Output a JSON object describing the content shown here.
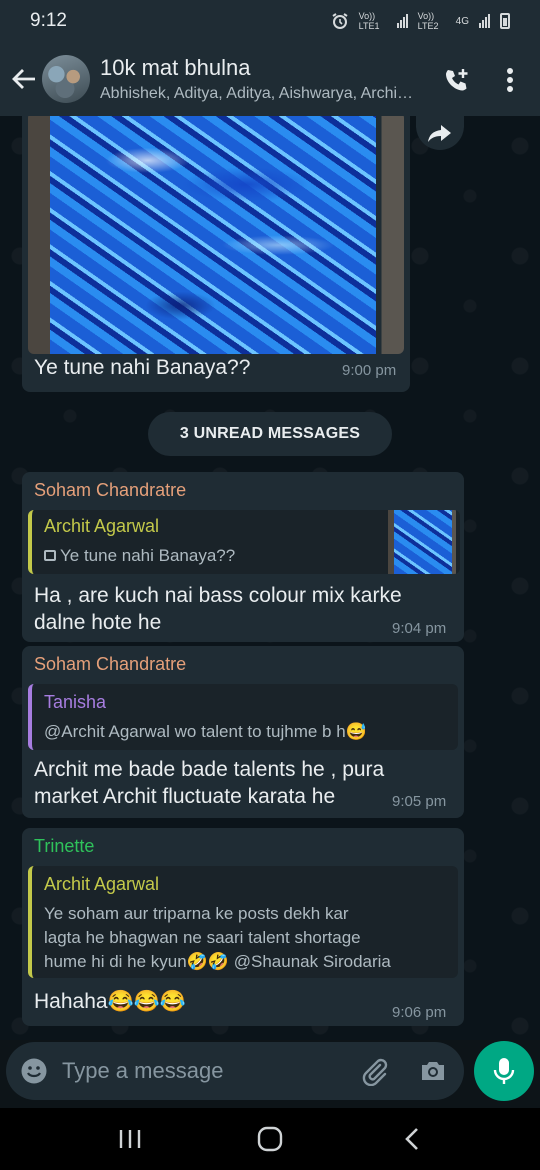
{
  "status_bar": {
    "time": "9:12",
    "sim1": "Vo)) LTE1",
    "sim2": "Vo)) LTE2",
    "net": "4G"
  },
  "header": {
    "group_name": "10k mat bhulna",
    "members": "Abhishek, Aditya, Aditya, Aishwarya, Archi…",
    "back_icon": "arrow-left-icon",
    "call_icon": "add-call-icon",
    "menu_icon": "more-vertical-icon"
  },
  "messages": {
    "image_msg": {
      "caption": "Ye tune nahi Banaya??",
      "time": "9:00 pm"
    },
    "unread_label": "3 UNREAD MESSAGES",
    "msg1": {
      "sender": "Soham Chandratre",
      "sender_color": "#e5a07a",
      "quote_name": "Archit Agarwal",
      "quote_name_color": "#c3c94a",
      "quote_text": "Ye tune nahi Banaya??",
      "text_line1": "Ha , are kuch nai bass colour mix karke",
      "text_line2": "dalne hote he",
      "time": "9:04 pm"
    },
    "msg2": {
      "sender": "Soham Chandratre",
      "sender_color": "#e5a07a",
      "quote_name": "Tanisha",
      "quote_name_color": "#a77de0",
      "quote_text": "@Archit Agarwal wo talent to tujhme b h😅",
      "text_line1": "Archit me bade bade talents he , pura",
      "text_line2": "market Archit fluctuate karata he",
      "time": "9:05 pm"
    },
    "msg3": {
      "sender": "Trinette",
      "sender_color": "#2fc25b",
      "quote_name": "Archit Agarwal",
      "quote_name_color": "#c3c94a",
      "quote_line1": "Ye soham aur triparna ke posts dekh kar",
      "quote_line2": "lagta he bhagwan ne saari talent shortage",
      "quote_line3": "hume hi di he kyun🤣🤣 @Shaunak Sirodaria",
      "text": "Hahaha😂😂😂",
      "time": "9:06 pm"
    }
  },
  "composer": {
    "placeholder": "Type a message",
    "emoji_icon": "emoji-icon",
    "attach_icon": "paperclip-icon",
    "camera_icon": "camera-icon",
    "mic_icon": "mic-icon"
  },
  "colors": {
    "accent": "#00a884",
    "bubble": "#1f2c34",
    "background": "#0b141a"
  }
}
